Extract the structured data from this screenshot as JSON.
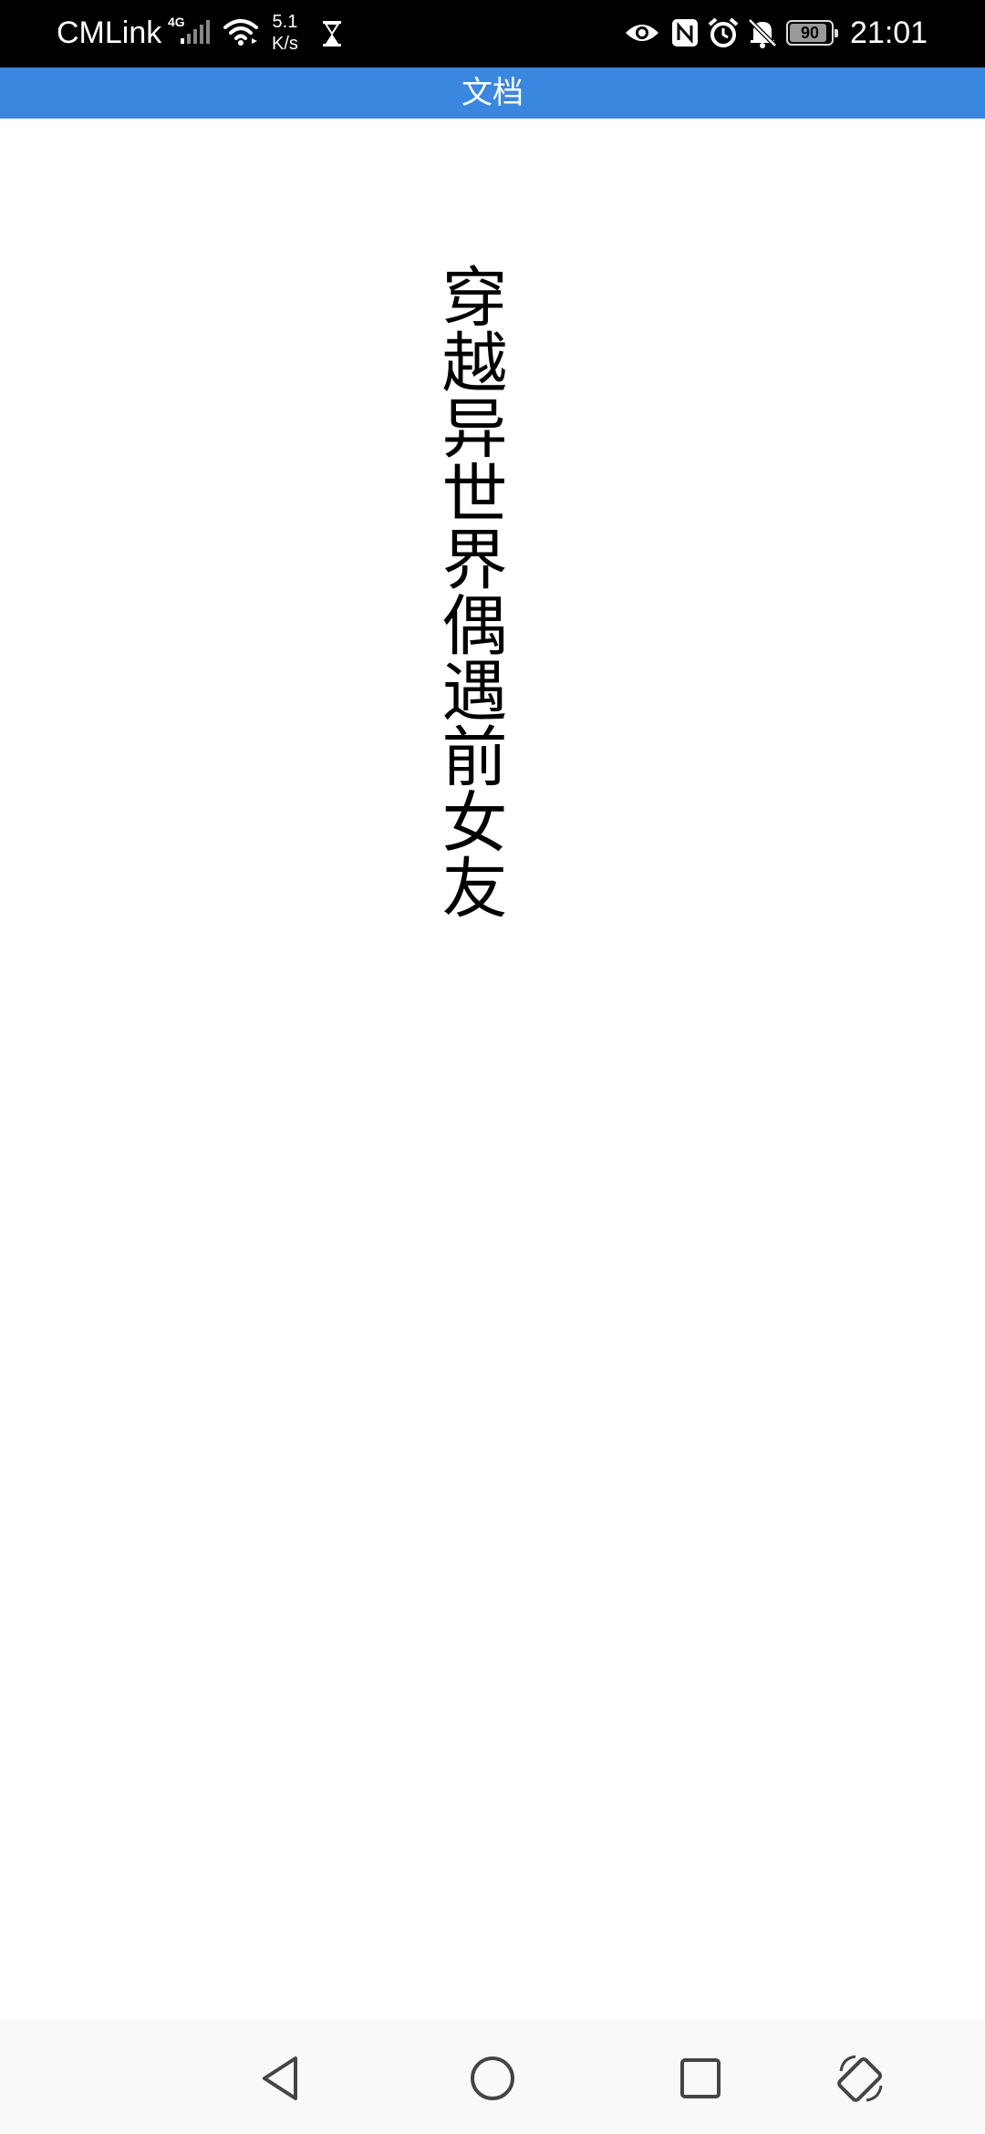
{
  "status_bar": {
    "carrier": "CMLink",
    "network_type": "4G",
    "speed_value": "5.1",
    "speed_unit": "K/s",
    "battery": "90",
    "battery_level": 0.9,
    "time": "21:01",
    "icons": [
      "signal-icon",
      "wifi-icon",
      "hourglass-icon",
      "eye-icon",
      "nfc-icon",
      "alarm-icon",
      "bell-off-icon",
      "battery-icon"
    ]
  },
  "app_bar": {
    "title": "文档"
  },
  "document": {
    "title": "穿越异世界偶遇前女友"
  },
  "nav_bar": {
    "icons": [
      "back-icon",
      "home-icon",
      "recent-apps-icon",
      "rotate-screen-icon"
    ]
  }
}
